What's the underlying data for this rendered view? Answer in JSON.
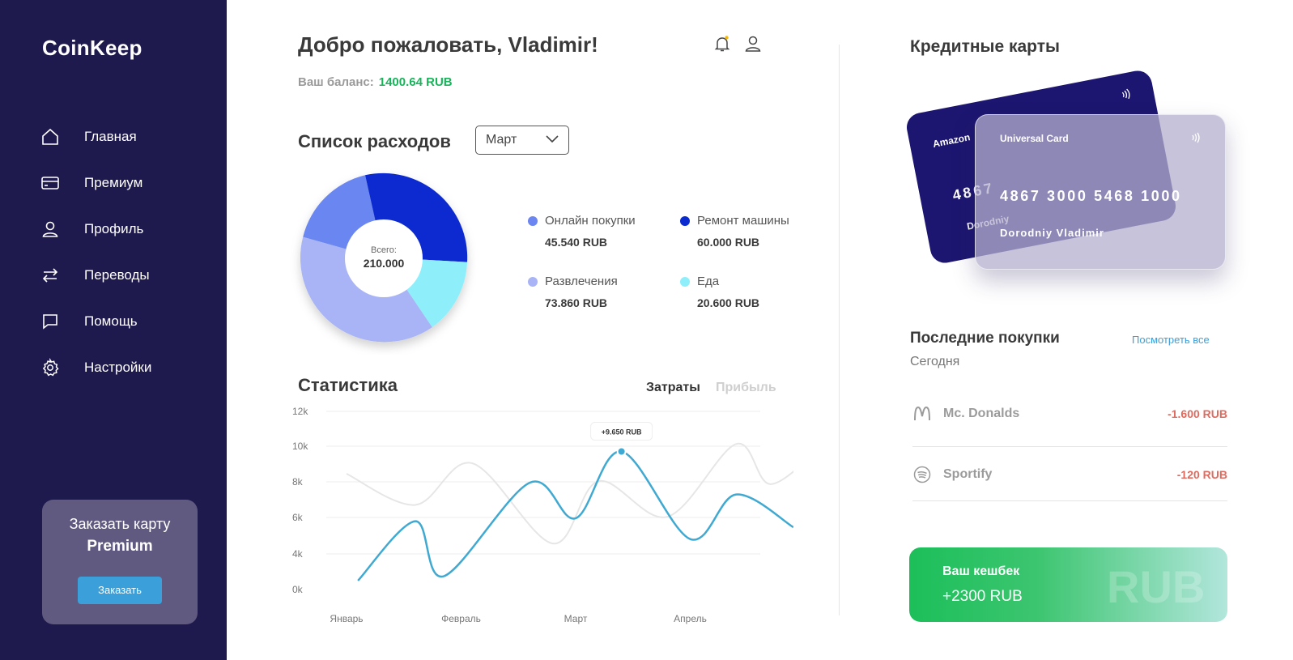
{
  "app": {
    "logo": "CoinKeep"
  },
  "sidebar": {
    "items": [
      {
        "label": "Главная",
        "icon": "home-icon"
      },
      {
        "label": "Премиум",
        "icon": "credit-card-icon"
      },
      {
        "label": "Профиль",
        "icon": "user-icon"
      },
      {
        "label": "Переводы",
        "icon": "transfer-icon"
      },
      {
        "label": "Помощь",
        "icon": "chat-icon"
      },
      {
        "label": "Настройки",
        "icon": "gear-icon"
      }
    ],
    "promo": {
      "line1": "Заказать карту",
      "line2": "Premium",
      "button": "Заказать"
    }
  },
  "header": {
    "welcome": "Добро пожаловать, Vladimir!",
    "balance_label": "Ваш баланс:",
    "balance_value": "1400.64  RUB"
  },
  "expenses": {
    "title": "Список расходов",
    "month": "Март",
    "total_label": "Всего:",
    "total_value": "210.000",
    "legend": [
      {
        "name": "Онлайн покупки",
        "value": "45.540 RUB",
        "color": "#6b86f0"
      },
      {
        "name": "Ремонт машины",
        "value": "60.000 RUB",
        "color": "#0a2bd0"
      },
      {
        "name": "Развлечения",
        "value": "73.860 RUB",
        "color": "#a8b4f5"
      },
      {
        "name": "Еда",
        "value": "20.600 RUB",
        "color": "#8eeffa"
      }
    ]
  },
  "stats": {
    "title": "Статистика",
    "tab_expenses": "Затраты",
    "tab_income": "Прибыль"
  },
  "chart_data": {
    "type": "line",
    "y_ticks": [
      "0k",
      "4k",
      "6k",
      "8k",
      "10k",
      "12k"
    ],
    "x_ticks": [
      "Январь",
      "Февраль",
      "Март",
      "Апрель"
    ],
    "tooltip": "+9.650 RUB",
    "series": [
      {
        "color": "#3fa9d2",
        "points": [
          [
            0.1,
            0.6
          ],
          [
            0.6,
            4.6
          ],
          [
            0.85,
            0.9
          ],
          [
            1.6,
            7.2
          ],
          [
            2.0,
            4.8
          ],
          [
            2.4,
            9.3
          ],
          [
            3.0,
            3.4
          ],
          [
            3.4,
            6.4
          ],
          [
            3.9,
            4.2
          ]
        ]
      },
      {
        "color": "#e6e6e6",
        "points": [
          [
            0.0,
            7.8
          ],
          [
            0.6,
            5.7
          ],
          [
            1.1,
            8.5
          ],
          [
            1.8,
            3.1
          ],
          [
            2.2,
            7.3
          ],
          [
            2.8,
            4.9
          ],
          [
            3.4,
            9.8
          ],
          [
            3.7,
            7.1
          ],
          [
            4.15,
            9.7
          ]
        ]
      }
    ],
    "ylim": [
      0,
      12
    ]
  },
  "cards": {
    "title": "Кредитные карты",
    "back": {
      "name": "Amazon",
      "number": "4867",
      "holder": "Dorodniy"
    },
    "front": {
      "name": "Universal Card",
      "number": "4867 3000 5468 1000",
      "holder": "Dorodniy Vladimir"
    }
  },
  "recent": {
    "title": "Последние покупки",
    "see_all": "Посмотреть все",
    "today": "Сегодня",
    "items": [
      {
        "name": "Mc. Donalds",
        "amount": "-1.600 RUB",
        "icon": "mcdonalds-icon"
      },
      {
        "name": "Sportify",
        "amount": "-120 RUB",
        "icon": "spotify-icon"
      }
    ]
  },
  "cashback": {
    "title": "Ваш  кешбек",
    "value": "+2300 RUB",
    "watermark": "RUB"
  }
}
